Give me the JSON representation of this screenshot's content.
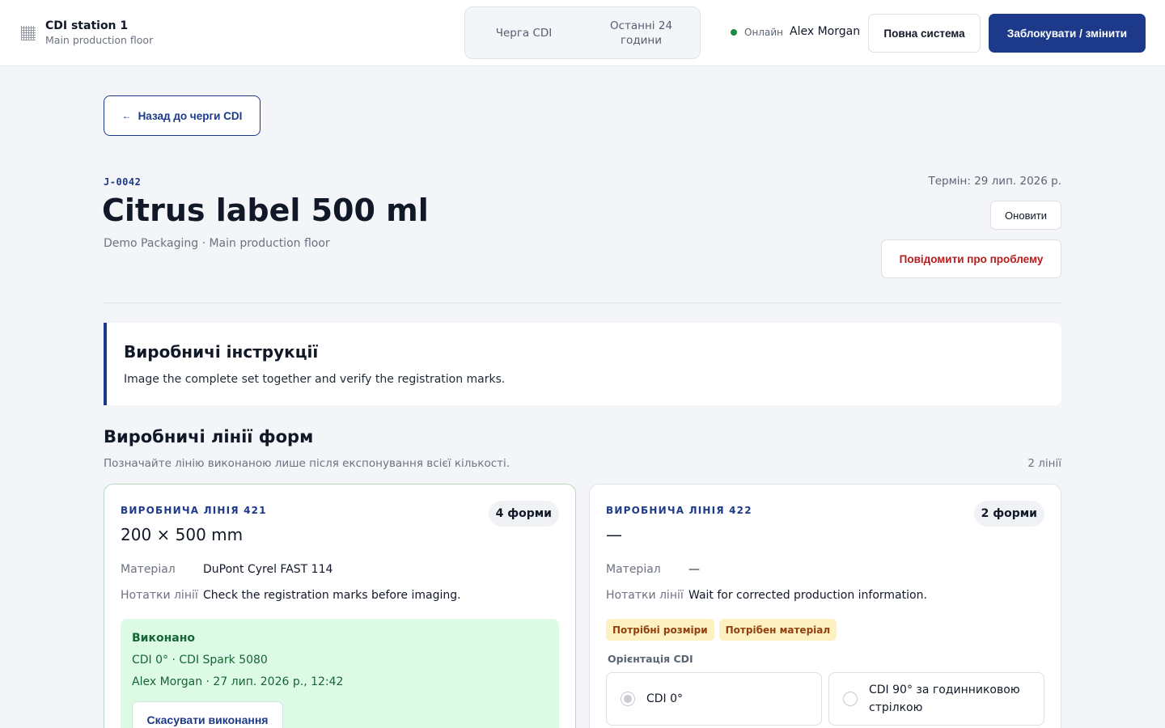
{
  "header": {
    "station_name": "CDI station 1",
    "station_location": "Main production floor",
    "tabs": [
      {
        "label": "Черга CDI"
      },
      {
        "label": "Останні 24 години"
      }
    ],
    "status_label": "Онлайн",
    "status_color": "#1f8a44",
    "user_name": "Alex Morgan",
    "full_system_label": "Повна система",
    "lock_label": "Заблокувати / змінити"
  },
  "back_label": "Назад до черги CDI",
  "job": {
    "id": "J-0042",
    "title": "Citrus label 500 ml",
    "subtitle": "Demo Packaging · Main production floor",
    "due": "Термін: 29 лип. 2026 р.",
    "refresh_label": "Оновити",
    "report_label": "Повідомити про проблему"
  },
  "instructions": {
    "title": "Виробничі інструкції",
    "text": "Image the complete set together and verify the registration marks."
  },
  "lines_section": {
    "title": "Виробничі лінії форм",
    "subtitle": "Позначайте лінію виконаною лише після експонування всієї кількості.",
    "count": "2 лінії"
  },
  "lines": [
    {
      "label": "ВИРОБНИЧА ЛІНІЯ 421",
      "forms": "4 форми",
      "size": "200 × 500 mm",
      "material_key": "Матеріал",
      "material": "DuPont Cyrel FAST 114",
      "notes_key": "Нотатки лінії",
      "notes": "Check the registration marks before imaging.",
      "done": {
        "title": "Виконано",
        "detail": "CDI 0° · CDI Spark 5080",
        "by": "Alex Morgan · 27 лип. 2026 р., 12:42",
        "cancel_label": "Скасувати виконання"
      }
    },
    {
      "label": "ВИРОБНИЧА ЛІНІЯ 422",
      "forms": "2 форми",
      "size": "—",
      "material_key": "Матеріал",
      "material": "—",
      "notes_key": "Нотатки лінії",
      "notes": "Wait for corrected production information.",
      "tags": [
        "Потрібні розміри",
        "Потрібен матеріал"
      ],
      "orientation_label": "Орієнтація CDI",
      "orientation_options": [
        "CDI 0°",
        "CDI 90° за годинниковою стрілкою"
      ],
      "orientation_selected": "CDI 0°"
    }
  ],
  "colors": {
    "accent": "#1d3a8a",
    "danger": "#b91c1c",
    "success_bg": "#dcfae6",
    "warning_bg": "#fdf1c2"
  }
}
